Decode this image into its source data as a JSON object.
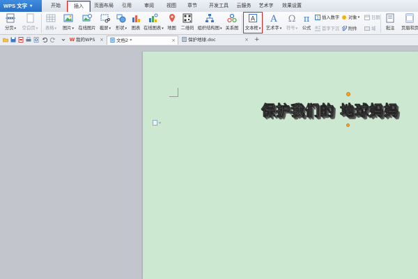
{
  "app": {
    "name": "WPS 文字",
    "menu_caret": "▾"
  },
  "ribbon_tabs": [
    {
      "label": "开始"
    },
    {
      "label": "插入"
    },
    {
      "label": "页面布局"
    },
    {
      "label": "引用"
    },
    {
      "label": "审阅"
    },
    {
      "label": "视图"
    },
    {
      "label": "章节"
    },
    {
      "label": "开发工具"
    },
    {
      "label": "云服务"
    },
    {
      "label": "艺术字"
    },
    {
      "label": "效果设置"
    }
  ],
  "ribbon": {
    "page_break": "分页",
    "blank_page": "空白页",
    "table": "表格",
    "picture": "图片",
    "online_picture": "在线图片",
    "screenshot": "截屏",
    "shape": "形状",
    "chart": "图表",
    "online_chart": "在线图表",
    "map": "地图",
    "qrcode": "二维码",
    "org_chart": "组织结构图",
    "relation": "关系图",
    "textbox": "文本框",
    "wordart": "艺术字",
    "symbol": "符号",
    "formula": "公式",
    "insert_number": "插入数字",
    "object": "对象",
    "date": "日期",
    "first_letter": "首字下沉",
    "attachment": "附件",
    "field": "域",
    "comment": "批注",
    "header_footer": "页眉和页"
  },
  "doc_tabs": [
    {
      "label": "我的WPS"
    },
    {
      "label": "文档2 *"
    },
    {
      "label": "保护地球.doc"
    }
  ],
  "new_tab": "+",
  "close_glyph": "×",
  "document": {
    "wordart_text": "保护我们的 地球妈妈"
  },
  "colors": {
    "accent_blue": "#2a6fc4",
    "highlight_red": "#e02020",
    "page_green": "#cde8d1",
    "workspace_gray": "#c2c5cc"
  }
}
